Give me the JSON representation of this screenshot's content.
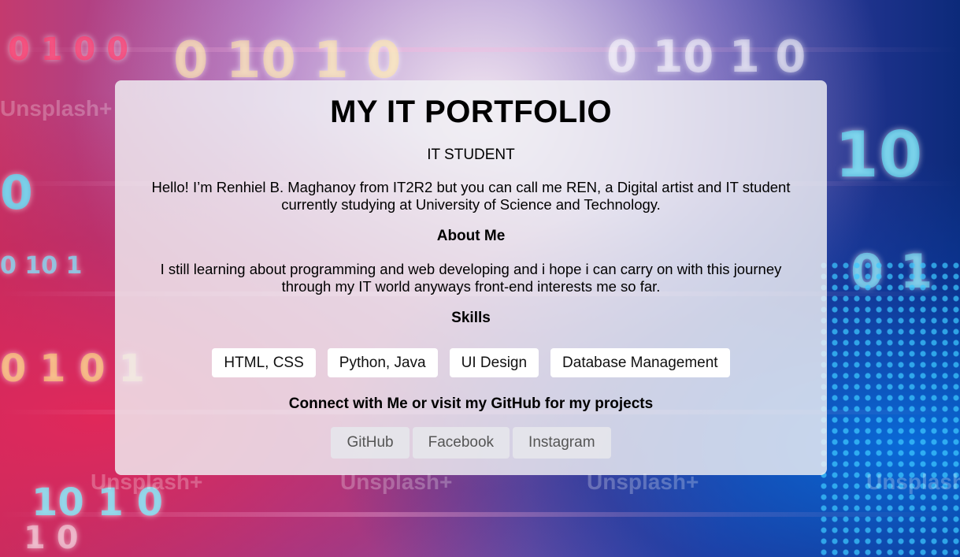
{
  "header": {
    "title": "MY IT PORTFOLIO",
    "subtitle": "IT STUDENT"
  },
  "intro": {
    "text": "Hello! I’m Renhiel B. Maghanoy from IT2R2 but you can call me REN, a Digital artist and IT student currently studying at University of Science and Technology."
  },
  "about": {
    "heading": "About Me",
    "text": "I still learning about programming and web developing and i hope i can carry on with this journey through my IT world anyways front-end interests me so far."
  },
  "skills": {
    "heading": "Skills",
    "items": [
      "HTML, CSS",
      "Python, Java",
      "UI Design",
      "Database Management"
    ]
  },
  "connect": {
    "heading": "Connect with Me or visit my GitHub for my projects",
    "links": [
      "GitHub",
      "Facebook",
      "Instagram"
    ]
  },
  "background": {
    "watermark": "Unsplash+"
  },
  "colors": {
    "card_background": "#f0f0f4",
    "skill_chip": "#ffffff",
    "link_text": "#555555"
  }
}
